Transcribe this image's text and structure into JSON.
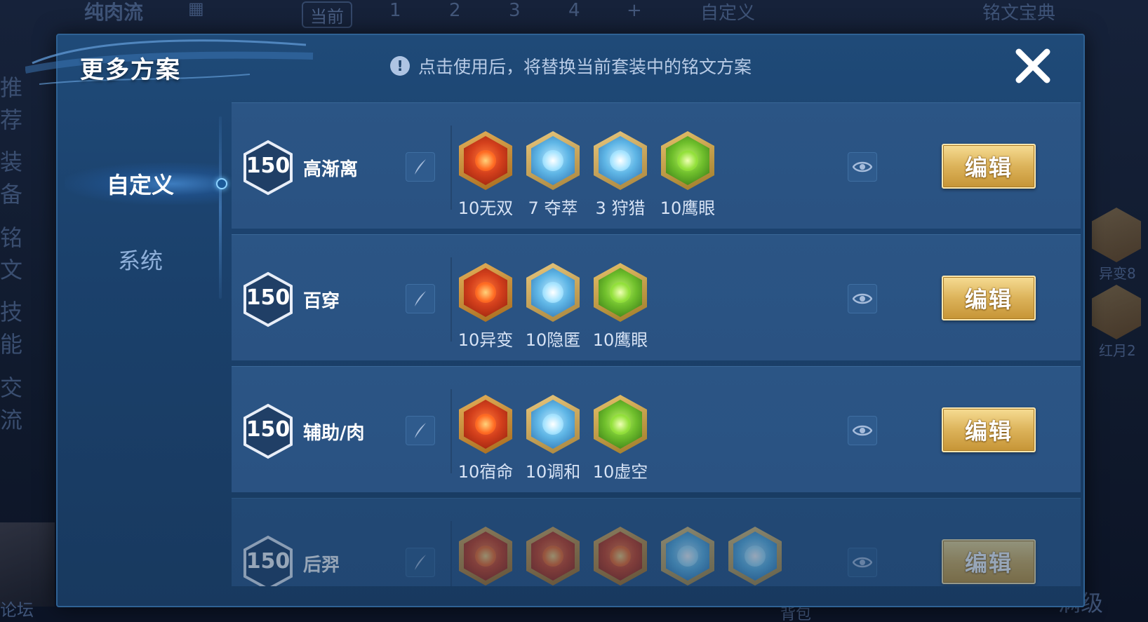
{
  "background": {
    "scheme_title": "纯肉流",
    "top_tabs": [
      "当前",
      "1",
      "2",
      "3",
      "4",
      "+"
    ],
    "custom_tab": "自定义",
    "codex": "铭文宝典",
    "side_items": [
      "推荐",
      "装备",
      "铭文",
      "技能",
      "交流"
    ],
    "right_labels": [
      "异变8",
      "红月2"
    ],
    "bottom_left": "论坛",
    "bottom_right": "满级",
    "bottom_mid": "背包"
  },
  "modal": {
    "title": "更多方案",
    "hint_icon": "!",
    "hint": "点击使用后，将替换当前套装中的铭文方案",
    "close_icon": "close-icon"
  },
  "nav": {
    "items": [
      {
        "label": "自定义",
        "active": true
      },
      {
        "label": "系统",
        "active": false
      }
    ]
  },
  "schemes": [
    {
      "level": "150",
      "name": "高渐离",
      "runes": [
        {
          "color": "red",
          "label": "10无双"
        },
        {
          "color": "blue",
          "label": "7 夺萃"
        },
        {
          "color": "blue",
          "label": "3 狩猎"
        },
        {
          "color": "green",
          "label": "10鹰眼"
        }
      ],
      "edit_label": "编辑"
    },
    {
      "level": "150",
      "name": "百穿",
      "runes": [
        {
          "color": "red",
          "label": "10异变"
        },
        {
          "color": "blue",
          "label": "10隐匿"
        },
        {
          "color": "green",
          "label": "10鹰眼"
        }
      ],
      "edit_label": "编辑"
    },
    {
      "level": "150",
      "name": "辅助/肉",
      "runes": [
        {
          "color": "red",
          "label": "10宿命"
        },
        {
          "color": "blue",
          "label": "10调和"
        },
        {
          "color": "green",
          "label": "10虚空"
        }
      ],
      "edit_label": "编辑"
    },
    {
      "level": "150",
      "name": "后羿",
      "runes": [
        {
          "color": "red",
          "label": ""
        },
        {
          "color": "red",
          "label": ""
        },
        {
          "color": "red",
          "label": ""
        },
        {
          "color": "blue",
          "label": ""
        },
        {
          "color": "blue",
          "label": ""
        }
      ],
      "edit_label": "编辑"
    }
  ]
}
